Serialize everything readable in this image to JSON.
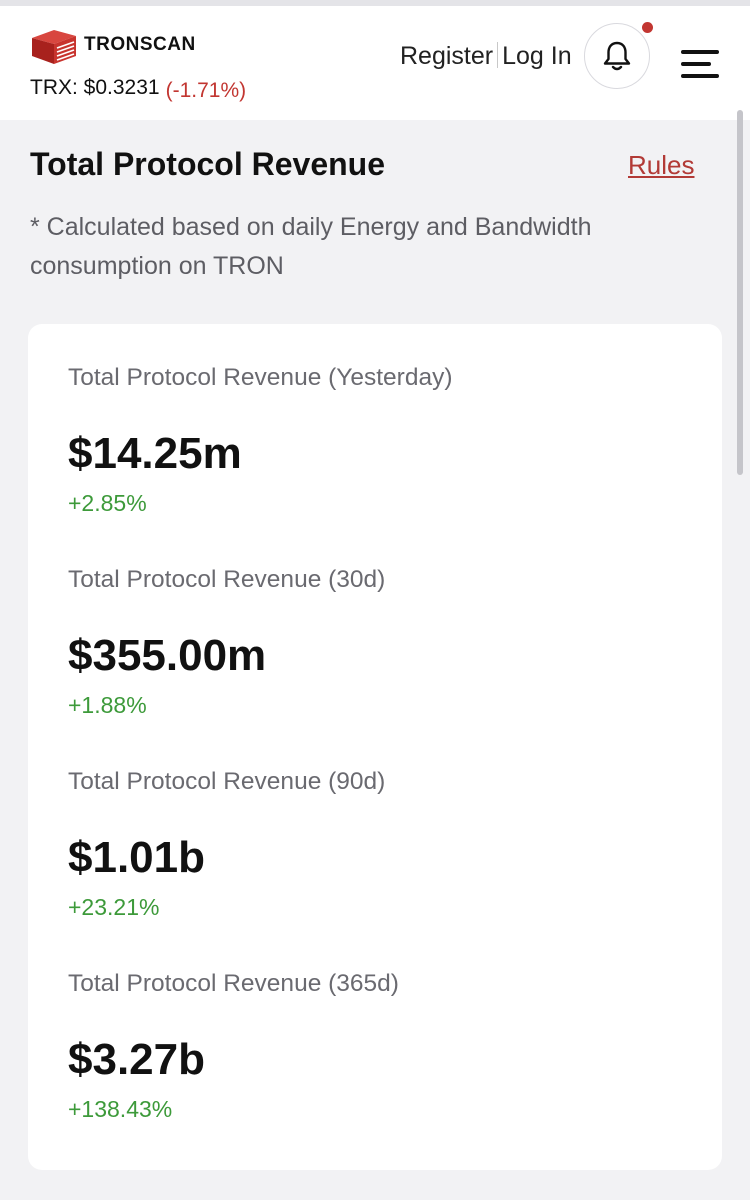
{
  "header": {
    "brand": "TRONSCAN",
    "price_label": "TRX: $0.3231",
    "price_change": "(-1.71%)",
    "register": "Register",
    "login": "Log In"
  },
  "colors": {
    "brand_red": "#c23631",
    "positive_green": "#3d9a3a",
    "link_red": "#b23a36"
  },
  "icons": [
    "tronscan-logo-icon",
    "bell-icon",
    "notification-dot",
    "menu-icon"
  ],
  "page": {
    "title": "Total Protocol Revenue",
    "rules_link": "Rules",
    "note": "* Calculated based on daily Energy and Bandwidth consumption on TRON"
  },
  "metrics": [
    {
      "label": "Total Protocol Revenue (Yesterday)",
      "value": "$14.25m",
      "change": "+2.85%"
    },
    {
      "label": "Total Protocol Revenue (30d)",
      "value": "$355.00m",
      "change": "+1.88%"
    },
    {
      "label": "Total Protocol Revenue (90d)",
      "value": "$1.01b",
      "change": "+23.21%"
    },
    {
      "label": "Total Protocol Revenue (365d)",
      "value": "$3.27b",
      "change": "+138.43%"
    }
  ]
}
